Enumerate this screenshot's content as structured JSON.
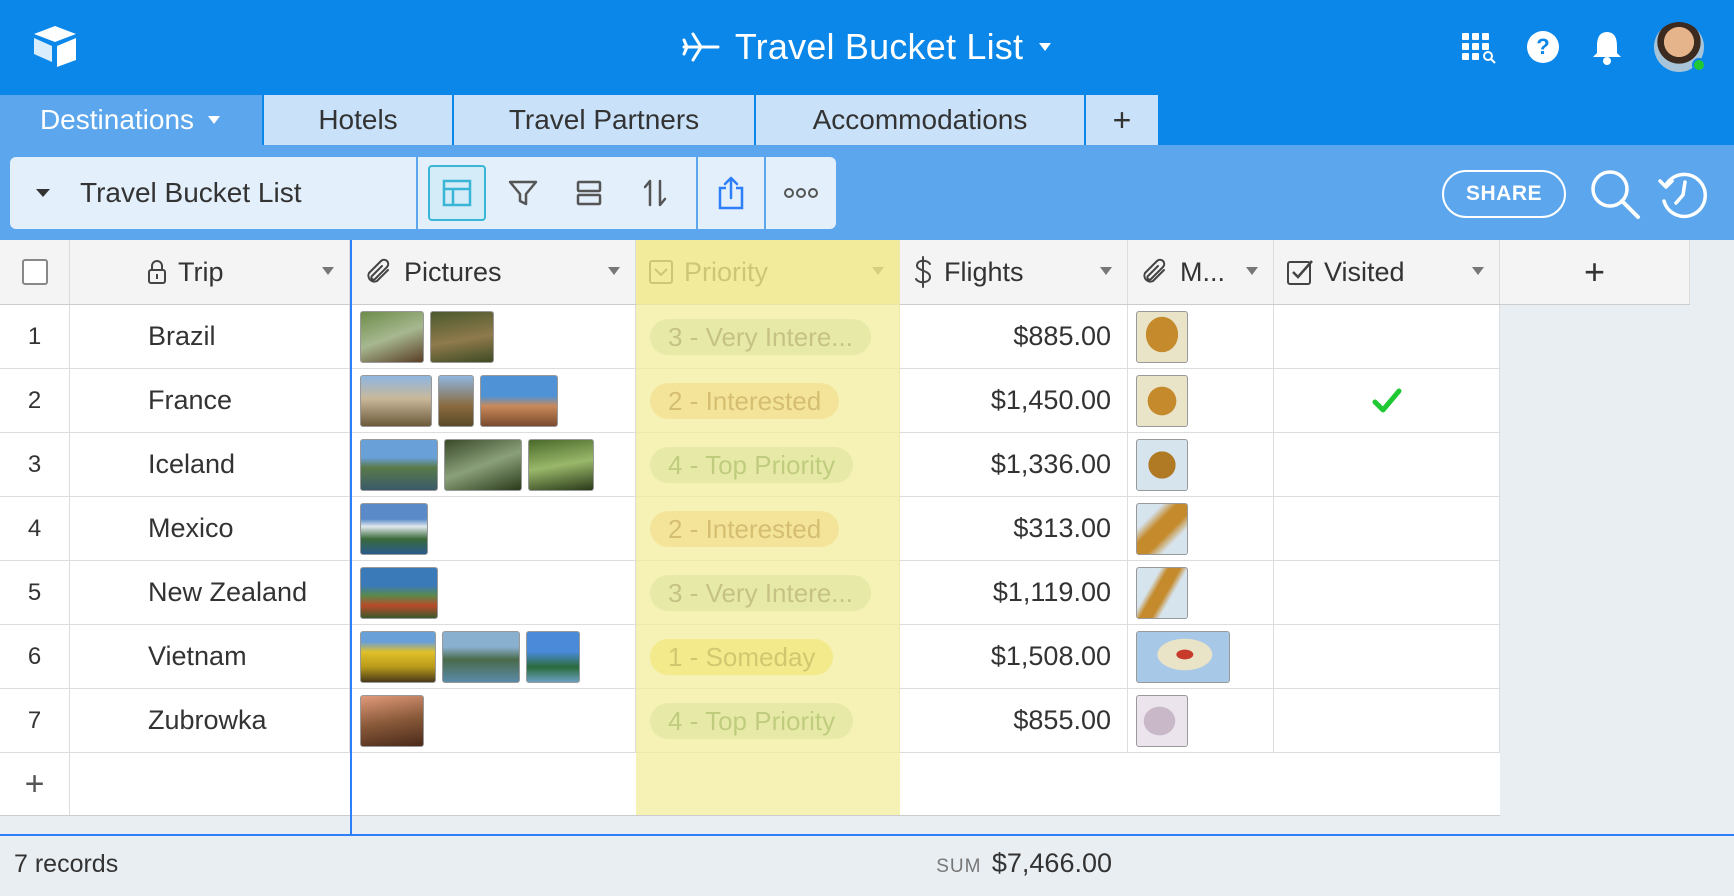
{
  "app": {
    "base_title": "Travel Bucket List"
  },
  "colors": {
    "topbar": "#0a87e8",
    "viewbar": "#5ba6ec",
    "priority_highlight": "#f2ec99",
    "checkmark": "#20c933"
  },
  "tabs": [
    {
      "label": "Destinations",
      "active": true
    },
    {
      "label": "Hotels",
      "active": false
    },
    {
      "label": "Travel Partners",
      "active": false
    },
    {
      "label": "Accommodations",
      "active": false
    },
    {
      "label": "+",
      "active": false
    }
  ],
  "view": {
    "name": "Travel Bucket List",
    "share_label": "SHARE"
  },
  "columns": [
    {
      "label": "Trip",
      "icon": "lock-icon"
    },
    {
      "label": "Pictures",
      "icon": "paperclip-icon"
    },
    {
      "label": "Priority",
      "icon": "single-select-icon"
    },
    {
      "label": "Flights",
      "icon": "dollar-icon"
    },
    {
      "label": "M...",
      "icon": "paperclip-icon"
    },
    {
      "label": "Visited",
      "icon": "checkbox-icon"
    },
    {
      "label": "+",
      "icon": "plus-icon"
    }
  ],
  "rows": [
    {
      "num": "1",
      "trip": "Brazil",
      "pictures": 2,
      "priority": "3 - Very Intere...",
      "flights": "$885.00",
      "visited": false
    },
    {
      "num": "2",
      "trip": "France",
      "pictures": 3,
      "priority": "2 - Interested",
      "flights": "$1,450.00",
      "visited": true
    },
    {
      "num": "3",
      "trip": "Iceland",
      "pictures": 3,
      "priority": "4 - Top Priority",
      "flights": "$1,336.00",
      "visited": false
    },
    {
      "num": "4",
      "trip": "Mexico",
      "pictures": 1,
      "priority": "2 - Interested",
      "flights": "$313.00",
      "visited": false
    },
    {
      "num": "5",
      "trip": "New Zealand",
      "pictures": 1,
      "priority": "3 - Very Intere...",
      "flights": "$1,119.00",
      "visited": false
    },
    {
      "num": "6",
      "trip": "Vietnam",
      "pictures": 3,
      "priority": "1 - Someday",
      "flights": "$1,508.00",
      "visited": false
    },
    {
      "num": "7",
      "trip": "Zubrowka",
      "pictures": 1,
      "priority": "4 - Top Priority",
      "flights": "$855.00",
      "visited": false
    }
  ],
  "add_row_label": "+",
  "footer": {
    "records": "7 records",
    "sum_label": "SUM",
    "sum_value": "$7,466.00"
  }
}
